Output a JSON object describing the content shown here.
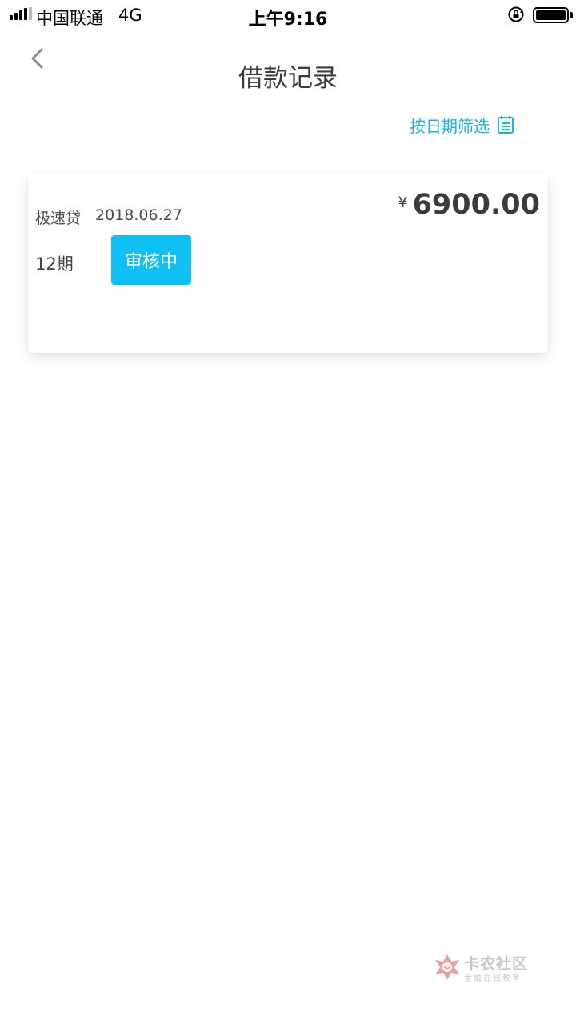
{
  "status_bar": {
    "carrier": "中国联通",
    "network": "4G",
    "time": "上午9:16",
    "icons": [
      "signal-icon",
      "rotation-lock-icon",
      "battery-icon"
    ]
  },
  "nav": {
    "back_icon": "chevron-left-icon",
    "title": "借款记录"
  },
  "filter": {
    "label": "按日期筛选",
    "icon": "calendar-icon"
  },
  "records": [
    {
      "product": "极速贷",
      "date": "2018.06.27",
      "currency": "¥",
      "amount": "6900.00",
      "term": "12期",
      "status": "审核中"
    }
  ],
  "watermark": {
    "title": "卡农社区",
    "subtitle": "金融在线教育"
  },
  "colors": {
    "accent": "#1ab4e6",
    "status_badge": "#10c0f5",
    "text_primary": "#3d3d3d",
    "background": "#ffffff"
  }
}
